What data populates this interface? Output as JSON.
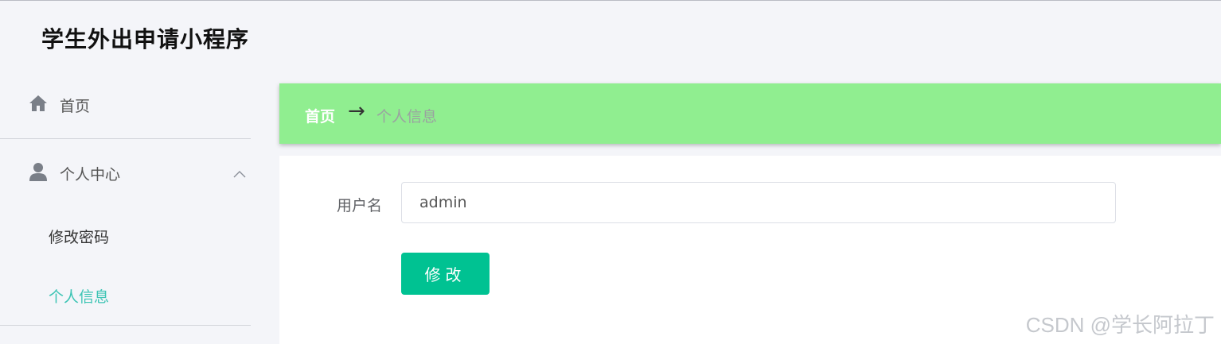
{
  "app": {
    "title": "学生外出申请小程序"
  },
  "sidebar": {
    "items": [
      {
        "label": "首页",
        "icon": "home-icon"
      },
      {
        "label": "个人中心",
        "icon": "user-icon",
        "expanded": true,
        "children": [
          {
            "label": "修改密码",
            "active": false
          },
          {
            "label": "个人信息",
            "active": true
          }
        ]
      }
    ]
  },
  "breadcrumb": {
    "home": "首页",
    "separator": "→",
    "current": "个人信息"
  },
  "form": {
    "username_label": "用户名",
    "username_value": "admin",
    "submit_label": "修改"
  },
  "watermark": "CSDN @学长阿拉丁",
  "colors": {
    "breadcrumb_bg": "#90ee90",
    "accent": "#00c292",
    "active_menu": "#3cc4b4",
    "page_bg": "#f4f5f9"
  }
}
